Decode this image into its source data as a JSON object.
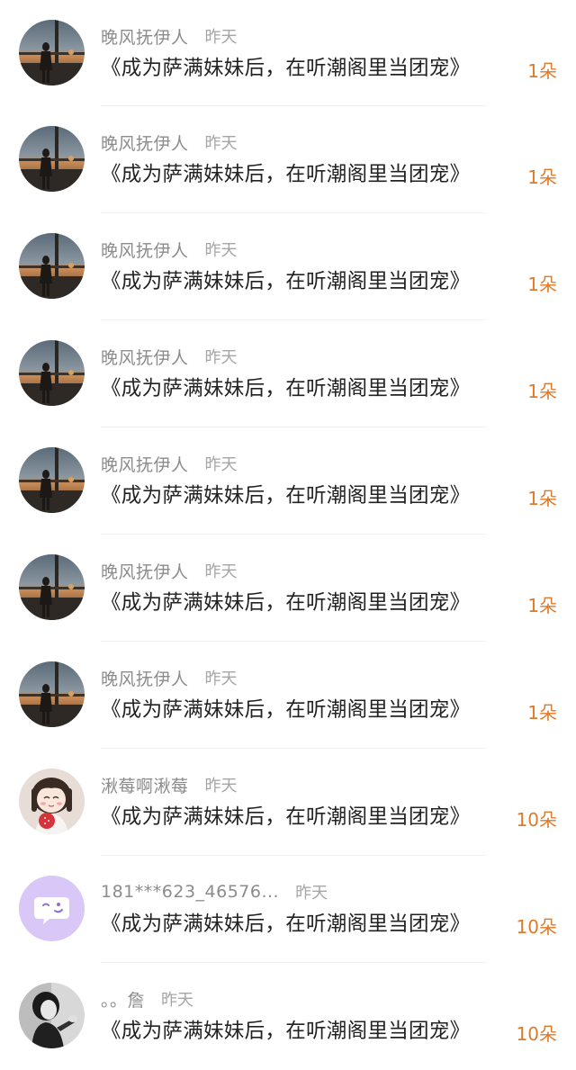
{
  "comments": [
    {
      "username": "晚风抚伊人",
      "time": "昨天",
      "book": "《成为萨满妹妹后，在听潮阁里当团宠》",
      "gift": "1朵",
      "avatar": "photo-avatar"
    },
    {
      "username": "晚风抚伊人",
      "time": "昨天",
      "book": "《成为萨满妹妹后，在听潮阁里当团宠》",
      "gift": "1朵",
      "avatar": "photo-avatar"
    },
    {
      "username": "晚风抚伊人",
      "time": "昨天",
      "book": "《成为萨满妹妹后，在听潮阁里当团宠》",
      "gift": "1朵",
      "avatar": "photo-avatar"
    },
    {
      "username": "晚风抚伊人",
      "time": "昨天",
      "book": "《成为萨满妹妹后，在听潮阁里当团宠》",
      "gift": "1朵",
      "avatar": "photo-avatar"
    },
    {
      "username": "晚风抚伊人",
      "time": "昨天",
      "book": "《成为萨满妹妹后，在听潮阁里当团宠》",
      "gift": "1朵",
      "avatar": "photo-avatar"
    },
    {
      "username": "晚风抚伊人",
      "time": "昨天",
      "book": "《成为萨满妹妹后，在听潮阁里当团宠》",
      "gift": "1朵",
      "avatar": "photo-avatar"
    },
    {
      "username": "晚风抚伊人",
      "time": "昨天",
      "book": "《成为萨满妹妹后，在听潮阁里当团宠》",
      "gift": "1朵",
      "avatar": "photo-avatar"
    },
    {
      "username": "湫莓啊湫莓",
      "time": "昨天",
      "book": "《成为萨满妹妹后，在听潮阁里当团宠》",
      "gift": "10朵",
      "avatar": "cartoon-girl-avatar"
    },
    {
      "username": "181***623_46576...",
      "time": "昨天",
      "book": "《成为萨满妹妹后，在听潮阁里当团宠》",
      "gift": "10朵",
      "avatar": "chat-bubble-avatar"
    },
    {
      "username": "。。詹",
      "time": "昨天",
      "book": "《成为萨满妹妹后，在听潮阁里当团宠》",
      "gift": "10朵",
      "avatar": "bw-photo-avatar"
    }
  ],
  "colors": {
    "gift": "#e07a2b",
    "username": "#8c8c8c",
    "time": "#a6a6a6",
    "title": "#222222",
    "chat_avatar_bg": "#d9c7f7"
  }
}
